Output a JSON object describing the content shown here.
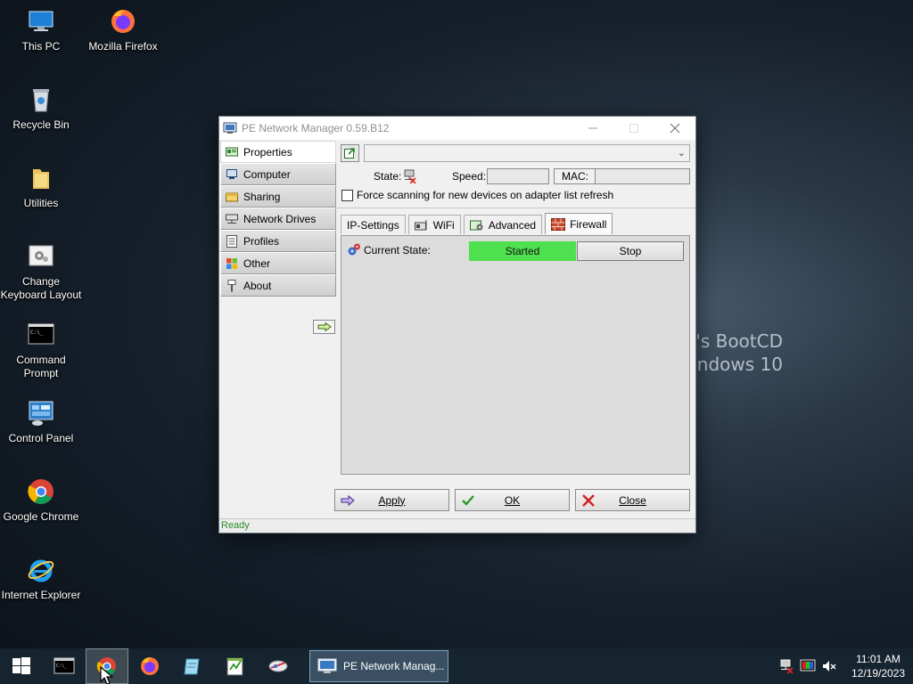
{
  "desktop": {
    "icons": [
      {
        "label": "This PC"
      },
      {
        "label": "Mozilla Firefox"
      },
      {
        "label": "Recycle Bin"
      },
      {
        "label": "Utilities"
      },
      {
        "label": "Change Keyboard Layout"
      },
      {
        "label": "Command Prompt"
      },
      {
        "label": "Control Panel"
      },
      {
        "label": "Google Chrome"
      },
      {
        "label": "Internet Explorer"
      }
    ],
    "wallpaper_text": [
      "en's BootCD",
      "Windows 10"
    ]
  },
  "window": {
    "title": "PE Network Manager 0.59.B12",
    "nav": [
      {
        "label": "Properties",
        "icon": "network-card-icon"
      },
      {
        "label": "Computer",
        "icon": "computer-icon"
      },
      {
        "label": "Sharing",
        "icon": "folder-share-icon"
      },
      {
        "label": "Network Drives",
        "icon": "network-drive-icon"
      },
      {
        "label": "Profiles",
        "icon": "profiles-icon"
      },
      {
        "label": "Other",
        "icon": "windows-logo-icon"
      },
      {
        "label": "About",
        "icon": "about-icon"
      }
    ],
    "adapter": {
      "selected": ""
    },
    "state_label": "State:",
    "speed_label": "Speed:",
    "speed_value": "",
    "mac_label": "MAC:",
    "mac_value": "",
    "force_scan_label": "Force scanning for new devices on adapter list refresh",
    "tabs": [
      {
        "label": "IP-Settings"
      },
      {
        "label": "WiFi"
      },
      {
        "label": "Advanced"
      },
      {
        "label": "Firewall"
      }
    ],
    "active_tab": "Firewall",
    "firewall": {
      "current_state_label": "Current State:",
      "state_value": "Started",
      "stop_label": "Stop"
    },
    "buttons": {
      "apply": "Apply",
      "ok": "OK",
      "close": "Close"
    },
    "status": "Ready"
  },
  "taskbar": {
    "task_label": "PE Network Manag...",
    "clock_time": "11:01 AM",
    "clock_date": "12/19/2023"
  },
  "colors": {
    "firewall_started": "#4fe04f",
    "status_text": "#2a8a2a",
    "taskbar": "#16242f"
  }
}
